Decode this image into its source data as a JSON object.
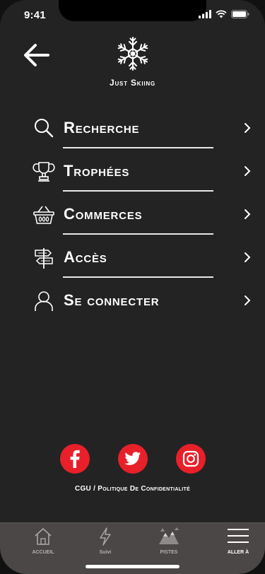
{
  "status": {
    "time": "9:41"
  },
  "app": {
    "title": "Just Skiing"
  },
  "menu": [
    {
      "label": "Recherche",
      "icon": "search-icon"
    },
    {
      "label": "Trophées",
      "icon": "trophy-icon"
    },
    {
      "label": "Commerces",
      "icon": "basket-icon"
    },
    {
      "label": "Accès",
      "icon": "signpost-icon"
    },
    {
      "label": "Se connecter",
      "icon": "user-icon"
    }
  ],
  "social": [
    "facebook-icon",
    "twitter-icon",
    "instagram-icon"
  ],
  "legal": "CGU / Politique De Confidentialité",
  "tabs": [
    {
      "label": "ACCUEIL",
      "icon": "home-icon",
      "active": false
    },
    {
      "label": "Suivi",
      "icon": "lightning-icon",
      "active": false
    },
    {
      "label": "PISTES",
      "icon": "mountain-icon",
      "active": false
    },
    {
      "label": "ALLER À",
      "icon": "menu-icon",
      "active": true
    }
  ],
  "colors": {
    "background": "#232323",
    "accent": "#e8202a",
    "tabbar": "#4b4747"
  }
}
